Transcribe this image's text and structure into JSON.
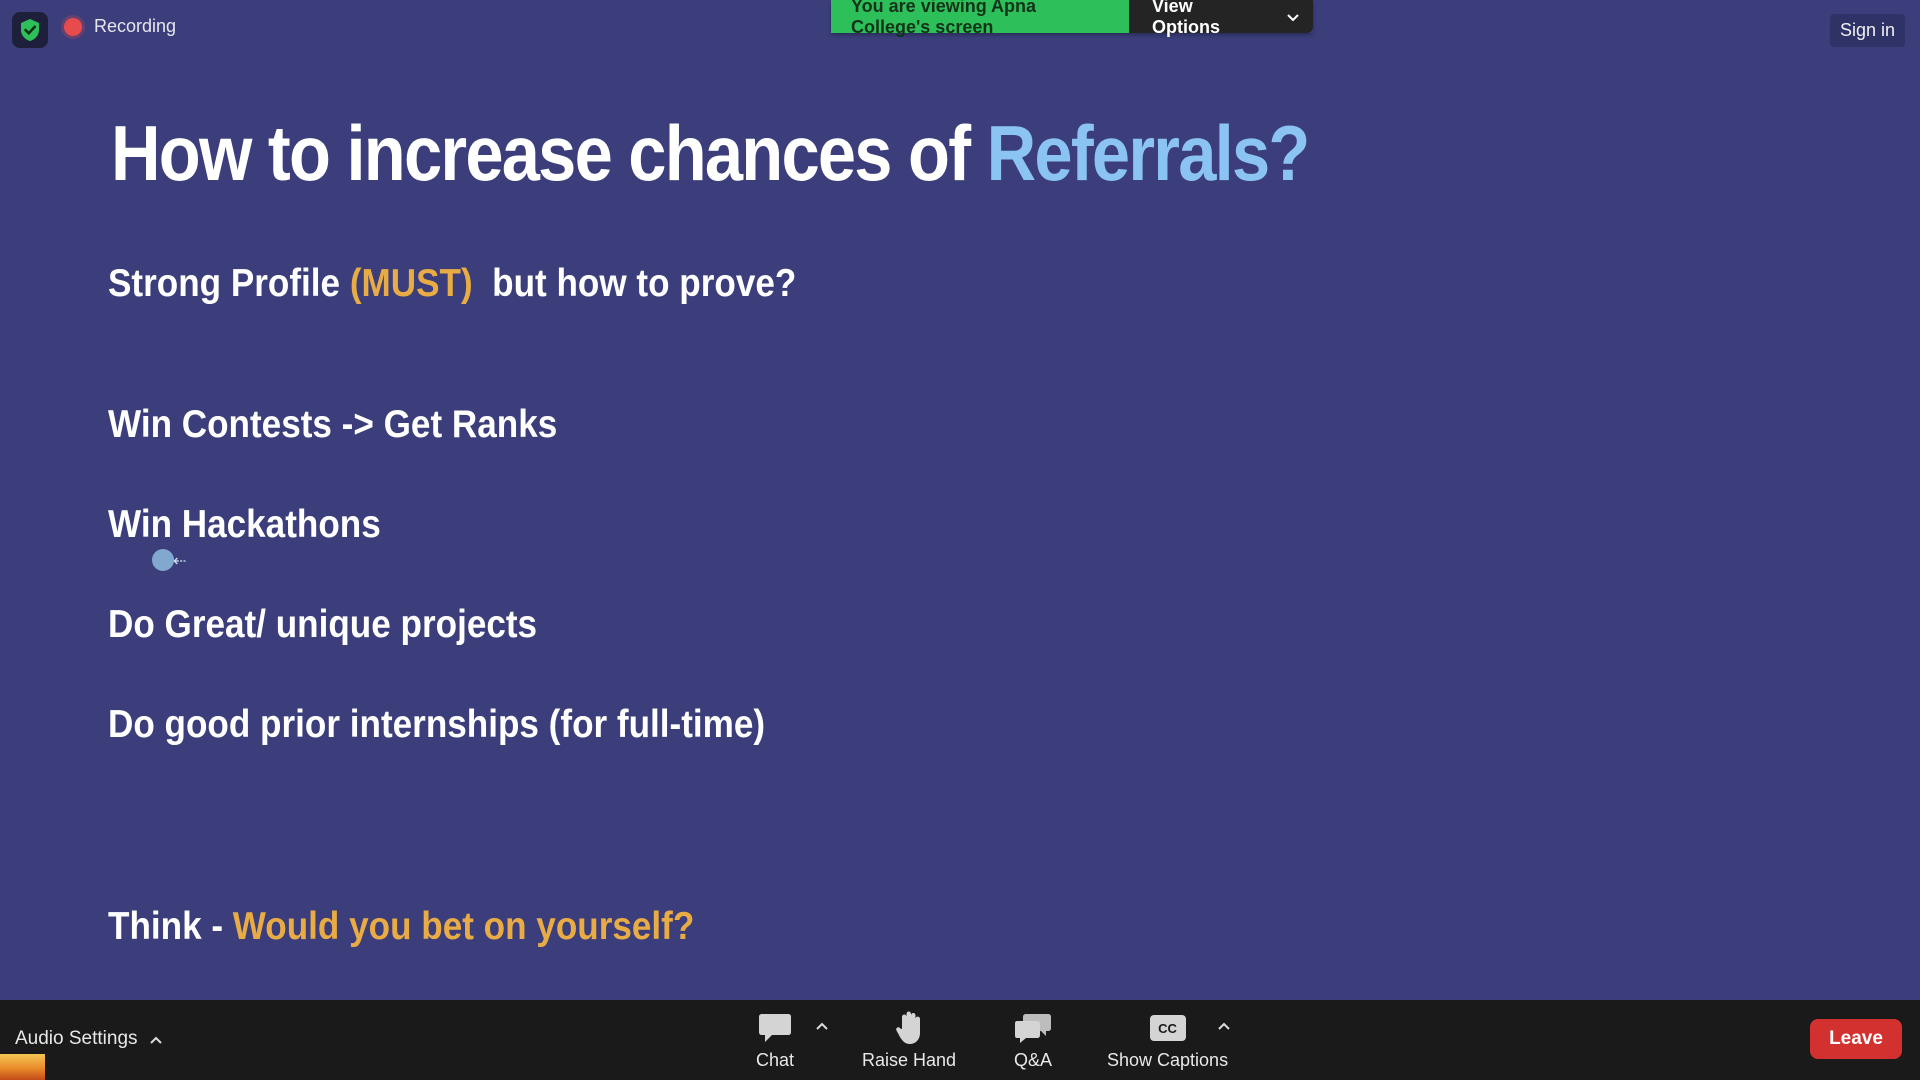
{
  "top": {
    "recording_label": "Recording",
    "banner_text": "You are viewing Apna College's screen",
    "view_options_label": "View Options",
    "sign_in_label": "Sign in",
    "shield_icon": "shield-check-icon"
  },
  "slide": {
    "title_prefix": "How to increase chances of ",
    "title_highlight": "Referrals?",
    "line1_a": "Strong Profile ",
    "line1_b": "(MUST)",
    "line1_c": "  but how to prove?",
    "line2": "Win Contests -> Get Ranks",
    "line3": "Win Hackathons",
    "line4": "Do Great/ unique projects",
    "line5": "Do good prior internships (for full-time)",
    "line6_a": "Think - ",
    "line6_b": "Would you bet on yourself?",
    "colors": {
      "background": "#3b3e7b",
      "highlight_blue": "#8bc4f2",
      "highlight_gold": "#e9ac45"
    }
  },
  "toolbar": {
    "audio_settings_label": "Audio Settings",
    "chat_label": "Chat",
    "raise_hand_label": "Raise Hand",
    "qa_label": "Q&A",
    "captions_label": "Show Captions",
    "captions_icon_text": "CC",
    "leave_label": "Leave",
    "leave_color": "#d3312f"
  }
}
